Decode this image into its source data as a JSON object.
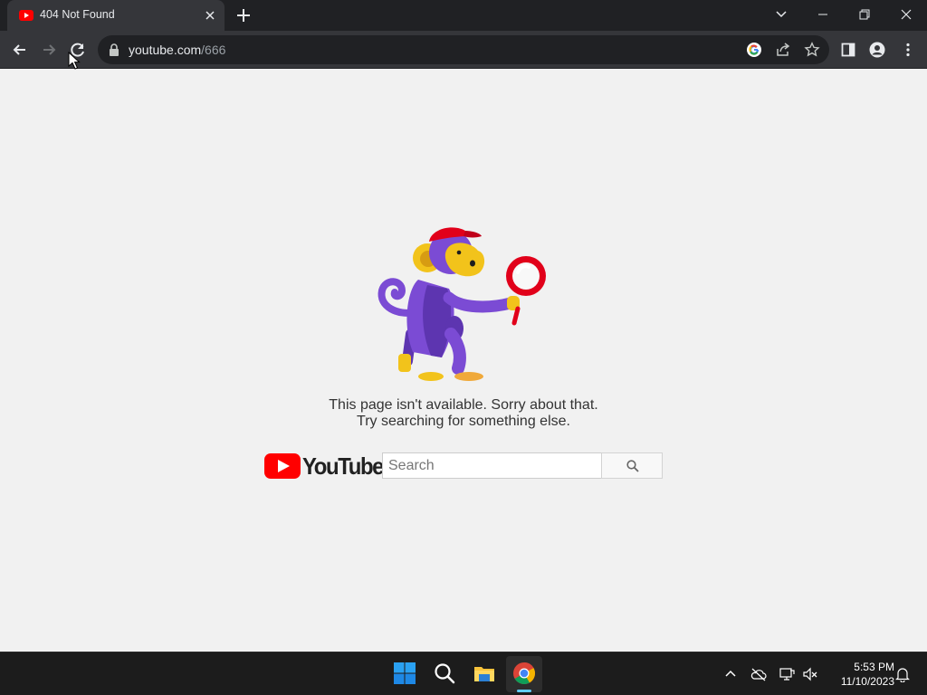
{
  "browser": {
    "tab": {
      "title": "404 Not Found",
      "favicon": "youtube-favicon-icon"
    },
    "new_tab_icon": "plus-icon",
    "window_controls": [
      "tab-search-icon",
      "minimize-icon",
      "restore-icon",
      "close-icon"
    ],
    "toolbar": {
      "nav_icons": [
        "back-arrow-icon",
        "forward-arrow-icon",
        "reload-icon"
      ],
      "url_host": "youtube.com",
      "url_path": "/666",
      "omnibox_icons": [
        "google-lens-icon",
        "share-icon",
        "bookmark-star-icon"
      ],
      "right_icons": [
        "side-panel-icon",
        "profile-icon",
        "kebab-menu-icon"
      ]
    }
  },
  "page": {
    "message_line1": "This page isn't available. Sorry about that.",
    "message_line2": "Try searching for something else.",
    "logo_text": "YouTube",
    "search": {
      "placeholder": "Search",
      "value": ""
    },
    "search_button_icon": "magnifier-icon",
    "colors": {
      "youtube_red": "#ff0000",
      "background": "#f1f1f1"
    }
  },
  "taskbar": {
    "apps": [
      "windows-start-icon",
      "search-icon",
      "file-explorer-icon",
      "chrome-icon"
    ],
    "active_app": "chrome-icon",
    "tray_icons": [
      "chevron-up-icon",
      "onedrive-offline-icon",
      "network-icon",
      "volume-muted-icon"
    ],
    "time": "5:53 PM",
    "date": "11/10/2023",
    "notification_icon": "bell-icon"
  }
}
